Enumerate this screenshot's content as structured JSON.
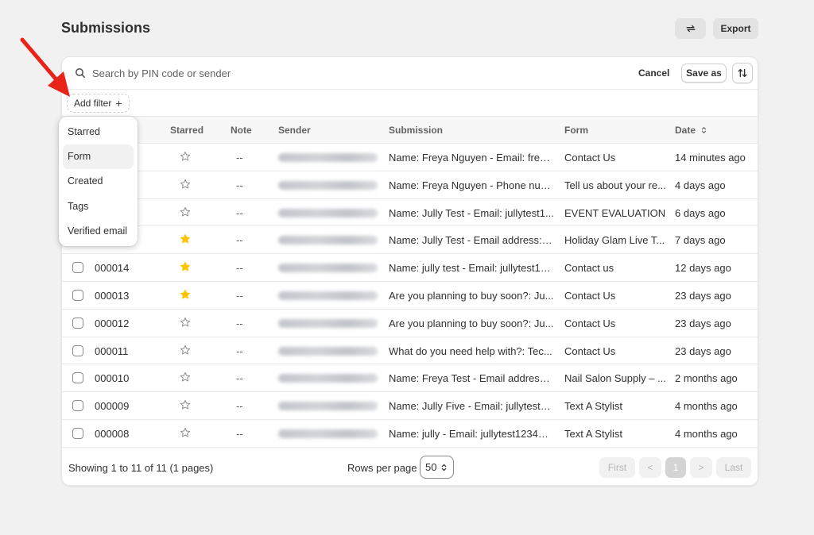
{
  "page": {
    "title": "Submissions",
    "export_label": "Export"
  },
  "search": {
    "placeholder": "Search by PIN code or sender",
    "value": "",
    "cancel_label": "Cancel",
    "save_as_label": "Save as"
  },
  "filter": {
    "add_label": "Add filter",
    "plus": "+"
  },
  "filter_menu": {
    "items": [
      "Starred",
      "Form",
      "Created",
      "Tags",
      "Verified email"
    ],
    "highlighted": "Form"
  },
  "table": {
    "headers": {
      "starred": "Starred",
      "note": "Note",
      "sender": "Sender",
      "submission": "Submission",
      "form": "Form",
      "date": "Date"
    },
    "rows": [
      {
        "pin": "",
        "starred": false,
        "note": "--",
        "submission": "Name: Freya Nguyen - Email: freya...",
        "form": "Contact Us",
        "date": "14 minutes ago"
      },
      {
        "pin": "",
        "starred": false,
        "note": "--",
        "submission": "Name: Freya Nguyen - Phone num...",
        "form": "Tell us about your re...",
        "date": "4 days ago"
      },
      {
        "pin": "",
        "starred": false,
        "note": "--",
        "submission": "Name: Jully Test - Email: jullytest1...",
        "form": "EVENT EVALUATION",
        "date": "6 days ago"
      },
      {
        "pin": "",
        "starred": true,
        "note": "--",
        "submission": "Name: Jully Test - Email address: j...",
        "form": "Holiday Glam Live T...",
        "date": "7 days ago"
      },
      {
        "pin": "000014",
        "starred": true,
        "note": "--",
        "submission": "Name: jully test - Email: jullytest12...",
        "form": "Contact us",
        "date": "12 days ago"
      },
      {
        "pin": "000013",
        "starred": true,
        "note": "--",
        "submission": "Are you planning to buy soon?: Ju...",
        "form": "Contact Us",
        "date": "23 days ago"
      },
      {
        "pin": "000012",
        "starred": false,
        "note": "--",
        "submission": "Are you planning to buy soon?: Ju...",
        "form": "Contact Us",
        "date": "23 days ago"
      },
      {
        "pin": "000011",
        "starred": false,
        "note": "--",
        "submission": "What do you need help with?: Tec...",
        "form": "Contact Us",
        "date": "23 days ago"
      },
      {
        "pin": "000010",
        "starred": false,
        "note": "--",
        "submission": "Name: Freya Test - Email address: ...",
        "form": "Nail Salon Supply – ...",
        "date": "2 months ago"
      },
      {
        "pin": "000009",
        "starred": false,
        "note": "--",
        "submission": "Name: Jully Five - Email: jullytest1...",
        "form": "Text A Stylist",
        "date": "4 months ago"
      },
      {
        "pin": "000008",
        "starred": false,
        "note": "--",
        "submission": "Name: jully - Email: jullytest1234@...",
        "form": "Text A Stylist",
        "date": "4 months ago"
      }
    ]
  },
  "footer": {
    "showing": "Showing 1 to 11 of 11 (1 pages)",
    "rows_per_page_label": "Rows per page",
    "rows_per_page_value": "50",
    "pagination": {
      "first": "First",
      "prev": "<",
      "current": "1",
      "next": ">",
      "last": "Last"
    }
  },
  "colors": {
    "star_filled": "#ffc400",
    "star_empty": "#8a8a8a",
    "annotation_arrow": "#e8231a"
  },
  "icons": {
    "sync": "sync-icon",
    "search": "search-icon",
    "sort": "sort-icon",
    "star": "star-icon",
    "chevron": "chevron-up-down-icon"
  }
}
